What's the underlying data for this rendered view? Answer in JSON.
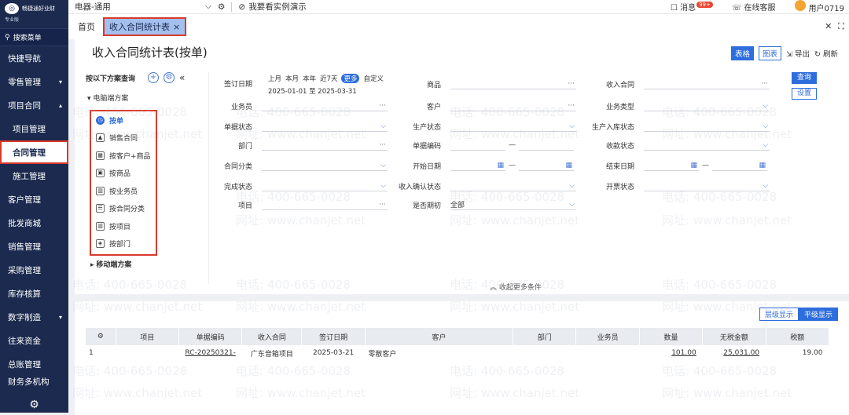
{
  "sidebar": {
    "brand_name": "畅捷通好业财",
    "brand_edition": "专业版",
    "search_label": "搜索菜单",
    "items": [
      {
        "label": "快捷导航",
        "arrow": ""
      },
      {
        "label": "零售管理",
        "arrow": "▾"
      },
      {
        "label": "项目合同",
        "arrow": "▴"
      },
      {
        "label": "项目管理",
        "arrow": ""
      },
      {
        "label": "合同管理",
        "arrow": ""
      },
      {
        "label": "施工管理",
        "arrow": ""
      },
      {
        "label": "客户管理",
        "arrow": ""
      },
      {
        "label": "批发商城",
        "arrow": ""
      },
      {
        "label": "销售管理",
        "arrow": ""
      },
      {
        "label": "采购管理",
        "arrow": ""
      },
      {
        "label": "库存核算",
        "arrow": ""
      },
      {
        "label": "数字制造",
        "arrow": "▾"
      },
      {
        "label": "往来资金",
        "arrow": ""
      },
      {
        "label": "总账管理",
        "arrow": ""
      },
      {
        "label": "财务多机构",
        "arrow": ""
      }
    ]
  },
  "topbar": {
    "industry_select": "电器-通用",
    "demo_label": "我要看实例演示",
    "messages_label": "消息",
    "messages_badge": "99+",
    "service_label": "在线客服",
    "user_label": "用户0719"
  },
  "tabs": {
    "home": "首页",
    "active": "收入合同统计表",
    "close": "×"
  },
  "page": {
    "title": "收入合同统计表(按单)",
    "view_table": "表格",
    "view_chart": "图表",
    "export": "导出",
    "refresh": "刷新"
  },
  "scheme_panel": {
    "query_label": "按以下方案查询",
    "pc_scheme": "电脑端方案",
    "mobile_scheme": "移动端方案",
    "schemes": [
      {
        "label": "按单",
        "icon": "clock-icon"
      },
      {
        "label": "销售合同",
        "icon": "mountain-icon"
      },
      {
        "label": "按客户+商品",
        "icon": "table-icon"
      },
      {
        "label": "按商品",
        "icon": "box-icon"
      },
      {
        "label": "按业务员",
        "icon": "bar-icon"
      },
      {
        "label": "按合同分类",
        "icon": "list-icon"
      },
      {
        "label": "按项目",
        "icon": "bar-icon"
      },
      {
        "label": "按部门",
        "icon": "cube-icon"
      }
    ]
  },
  "filters": {
    "sign_date_label": "签订日期",
    "date_shortcuts": [
      "上月",
      "本月",
      "本年",
      "近7天",
      "更多",
      "自定义"
    ],
    "date_range": "2025-01-01 至 2025-03-31",
    "salesman": "业务员",
    "doc_status": "单据状态",
    "department": "部门",
    "contract_category": "合同分类",
    "completion_status": "完成状态",
    "project": "项目",
    "product": "商品",
    "customer": "客户",
    "production_status": "生产状态",
    "doc_no": "单据编码",
    "start_date": "开始日期",
    "revenue_confirm_status": "收入确认状态",
    "is_opening": "是否期初",
    "is_opening_value": "全部",
    "income_contract": "收入合同",
    "business_type": "业务类型",
    "production_inbound_status": "生产入库状态",
    "receipt_status": "收款状态",
    "end_date": "结束日期",
    "invoice_status": "开票状态",
    "query_button": "查询",
    "settings_button": "设置",
    "collapse_label": "收起更多条件"
  },
  "results": {
    "level_display": "层级显示",
    "flat_display": "平级显示",
    "columns": [
      "项目",
      "单据编码",
      "收入合同",
      "签订日期",
      "客户",
      "部门",
      "业务员",
      "数量",
      "无税金额",
      "税额"
    ],
    "rows": [
      {
        "index": "1",
        "project": "",
        "doc_no": "RC-20250321-",
        "contract": "广东音箱项目",
        "sign_date": "2025-03-21",
        "customer": "零散客户",
        "department": "",
        "salesman": "",
        "quantity": "101.00",
        "amount": "25,031.00",
        "tax": "19.00"
      }
    ]
  },
  "watermark": {
    "phone": "电话: 400-665-0028",
    "site": "网址: www.chanjet.net"
  }
}
